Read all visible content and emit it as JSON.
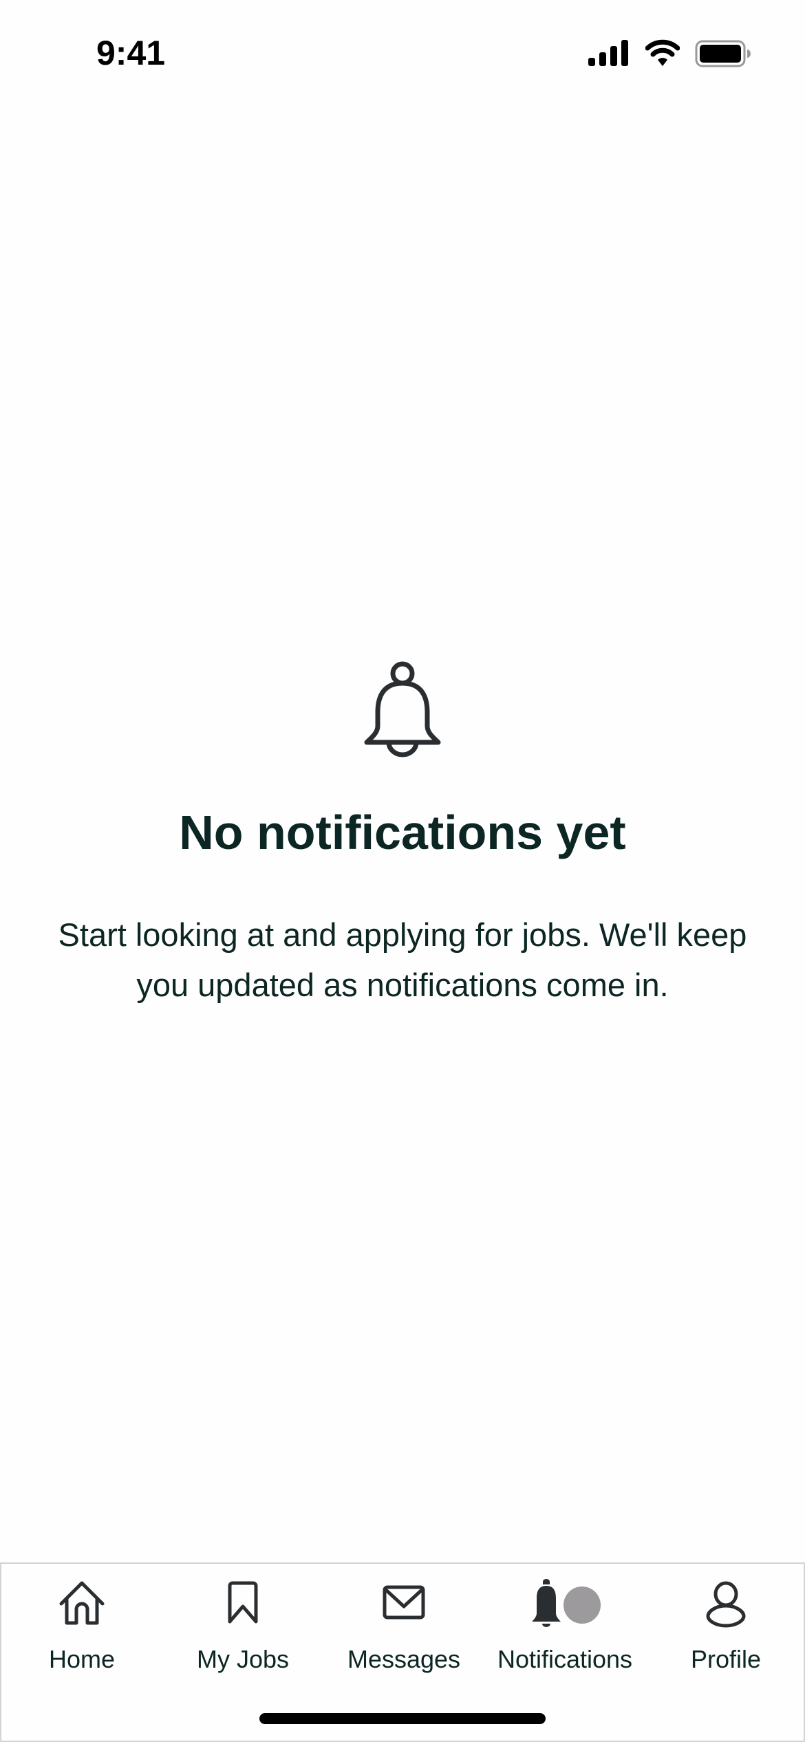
{
  "status_bar": {
    "time": "9:41",
    "icons": [
      "cellular-signal-icon",
      "wifi-icon",
      "battery-icon"
    ]
  },
  "empty_state": {
    "icon": "bell-outline-icon",
    "title": "No notifications yet",
    "description": "Start looking at and applying for jobs. We'll keep you updated as notifications come in."
  },
  "tab_bar": {
    "active": "Notifications",
    "items": [
      {
        "label": "Home",
        "icon": "home-icon"
      },
      {
        "label": "My Jobs",
        "icon": "bookmark-icon"
      },
      {
        "label": "Messages",
        "icon": "envelope-icon"
      },
      {
        "label": "Notifications",
        "icon": "bell-filled-icon"
      },
      {
        "label": "Profile",
        "icon": "person-icon"
      }
    ]
  },
  "colors": {
    "text_primary": "#0c2624",
    "icon": "#2b2e31",
    "badge": "#9c9a9c",
    "border": "#d3d3d3"
  }
}
